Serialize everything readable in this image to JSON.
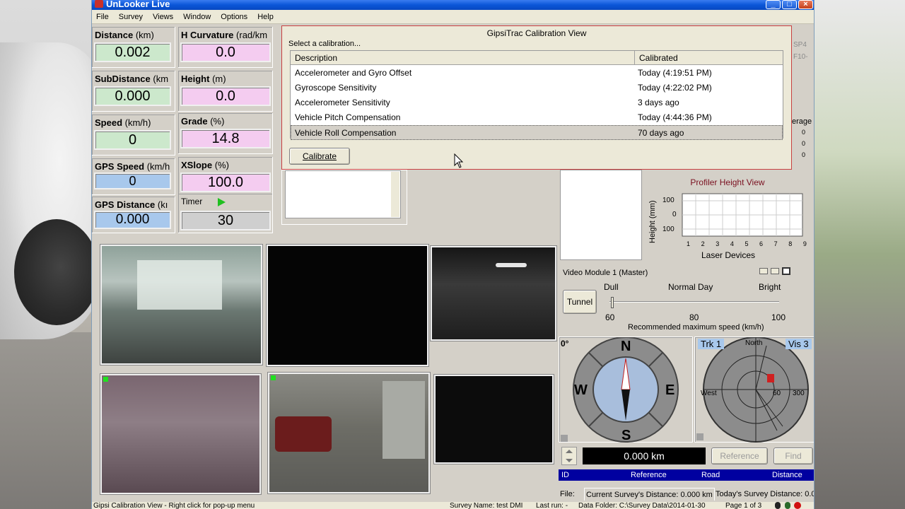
{
  "window": {
    "title": "UnLooker Live"
  },
  "menu": [
    "File",
    "Survey",
    "Views",
    "Window",
    "Options",
    "Help"
  ],
  "measurements": {
    "distance": {
      "label": "Distance",
      "unit": "(km)",
      "value": "0.002"
    },
    "h_curvature": {
      "label": "H Curvature",
      "unit": "(rad/km",
      "value": "0.0"
    },
    "subdistance": {
      "label": "SubDistance",
      "unit": "(km",
      "value": "0.000"
    },
    "height": {
      "label": "Height",
      "unit": "(m)",
      "value": "0.0"
    },
    "speed": {
      "label": "Speed",
      "unit": "(km/h)",
      "value": "0"
    },
    "grade": {
      "label": "Grade",
      "unit": "(%)",
      "value": "14.8"
    },
    "gps_speed": {
      "label": "GPS Speed",
      "unit": "(km/h",
      "value": "0"
    },
    "xslope": {
      "label": "XSlope",
      "unit": "(%)",
      "value": "100.0"
    },
    "gps_distance": {
      "label": "GPS Distance",
      "unit": "(kı",
      "value": "0.000"
    },
    "timer": {
      "label": "Timer",
      "value": "30"
    }
  },
  "calibration": {
    "title": "GipsiTrac Calibration View",
    "hint": "Select a calibration...",
    "columns": [
      "Description",
      "Calibrated"
    ],
    "rows": [
      {
        "description": "Accelerometer and Gyro Offset",
        "calibrated": "Today (4:19:51 PM)"
      },
      {
        "description": "Gyroscope Sensitivity",
        "calibrated": "Today (4:22:02 PM)"
      },
      {
        "description": "Accelerometer Sensitivity",
        "calibrated": "3 days ago"
      },
      {
        "description": "Vehicle Pitch Compensation",
        "calibrated": "Today (4:44:36 PM)"
      },
      {
        "description": "Vehicle Roll Compensation",
        "calibrated": "70 days ago"
      }
    ],
    "button": "Calibrate"
  },
  "behind_dialog": {
    "sp4": "SP4",
    "f10": "F10-",
    "average": "erage",
    "avg_values": [
      "0",
      "0",
      "0"
    ]
  },
  "profiler": {
    "title": "Profiler Height View",
    "ylabel": "Height (mm)",
    "xlabel": "Laser Devices",
    "yticks": [
      "100",
      "0",
      "100"
    ],
    "xticks": [
      "1",
      "2",
      "3",
      "4",
      "5",
      "6",
      "7",
      "8",
      "9"
    ]
  },
  "video_module": {
    "title": "Video Module 1 (Master)",
    "tunnel": "Tunnel",
    "scale_labels": [
      "Dull",
      "Normal Day",
      "Bright"
    ],
    "speeds": [
      "60",
      "80",
      "100"
    ],
    "caption": "Recommended maximum speed (km/h)"
  },
  "compass": {
    "angle_label": "0°",
    "n": "N",
    "s": "S",
    "e": "E",
    "w": "W"
  },
  "radar": {
    "trk": "Trk 1",
    "vis": "Vis 3",
    "north": "North",
    "west": "West",
    "r60": "60",
    "r300": "300"
  },
  "distance_bar": {
    "value": "0.000 km",
    "reference": "Reference",
    "find": "Find"
  },
  "table_headers": [
    "ID",
    "Reference",
    "Road",
    "Distance"
  ],
  "survey_info": {
    "file": "File:",
    "current": "Current Survey's Distance: 0.000 km",
    "today": "Today's Survey Distance: 0.0"
  },
  "status_bar": {
    "left": "Gipsi Calibration View - Right click for pop-up menu",
    "survey": "Survey Name: test DMI",
    "last_run": "Last run: -",
    "folder": "Data Folder: C:\\Survey Data\\2014-01-30",
    "page": "Page 1 of 3"
  },
  "colors": {
    "accent": "#0a56d8",
    "dialog_border": "#c84040",
    "table_header": "#0000a0"
  }
}
